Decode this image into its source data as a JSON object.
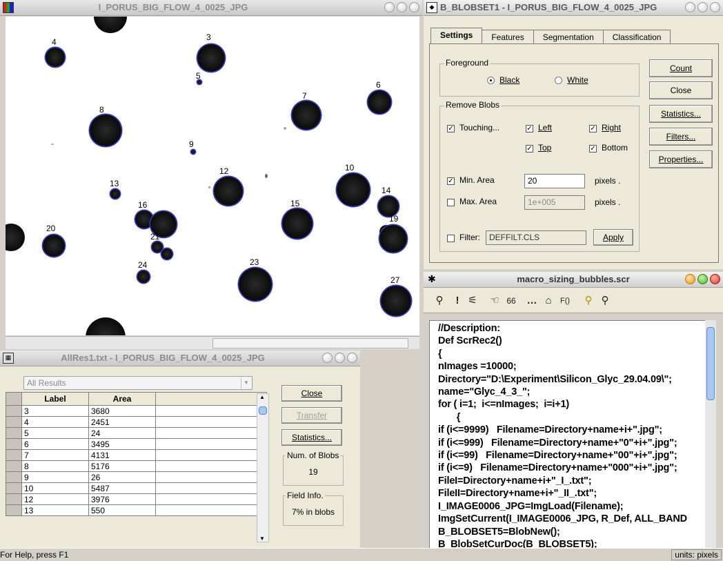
{
  "image_window": {
    "title": "I_PORUS_BIG_FLOW_4_0025_JPG",
    "blobs": [
      {
        "label": "3"
      },
      {
        "label": "4"
      },
      {
        "label": "5"
      },
      {
        "label": "6"
      },
      {
        "label": "7"
      },
      {
        "label": "8"
      },
      {
        "label": "9"
      },
      {
        "label": "10"
      },
      {
        "label": "12"
      },
      {
        "label": "13"
      },
      {
        "label": "14"
      },
      {
        "label": "15"
      },
      {
        "label": "16"
      },
      {
        "label": "19"
      },
      {
        "label": "20"
      },
      {
        "label": "21"
      },
      {
        "label": "23"
      },
      {
        "label": "24"
      },
      {
        "label": "27"
      }
    ]
  },
  "blobset_window": {
    "title": "B_BLOBSET1 - I_PORUS_BIG_FLOW_4_0025_JPG",
    "tabs": [
      "Settings",
      "Features",
      "Segmentation",
      "Classification"
    ],
    "foreground_label": "Foreground",
    "black_label": "Black",
    "white_label": "White",
    "foreground_value": "Black",
    "remove_blobs_label": "Remove Blobs",
    "touching_label": "Touching...",
    "left_label": "Left",
    "right_label": "Right",
    "top_label": "Top",
    "bottom_label": "Bottom",
    "min_area_label": "Min. Area",
    "min_area_value": "20",
    "max_area_label": "Max. Area",
    "max_area_value": "1e+005",
    "pixels_label": "pixels .",
    "filter_label": "Filter:",
    "filter_value": "DEFFILT.CLS",
    "apply_label": "Apply",
    "buttons": {
      "count": "Count",
      "close": "Close",
      "statistics": "Statistics...",
      "filters": "Filters...",
      "properties": "Properties..."
    }
  },
  "macro_window": {
    "title": "macro_sizing_bubbles.scr",
    "code": [
      "//Description:",
      "Def ScrRec2()",
      "{",
      "nImages =10000;",
      "Directory=\"D:\\Experiment\\Silicon_Glyc_29.04.09\\\";",
      "name=\"Glyc_4_3_\";",
      "for ( i=1;  i<=nImages;  i=i+1)",
      "       {",
      "if (i<=9999)   Filename=Directory+name+i+\".jpg\";",
      "if (i<=999)   Filename=Directory+name+\"0\"+i+\".jpg\";",
      "if (i<=99)   Filename=Directory+name+\"00\"+i+\".jpg\";",
      "if (i<=9)   Filename=Directory+name+\"000\"+i+\".jpg\";",
      "FileI=Directory+name+i+\"_I_.txt\";",
      "FileII=Directory+name+i+\"_II_.txt\";",
      "I_IMAGE0006_JPG=ImgLoad(Filename);",
      "ImgSetCurrent(I_IMAGE0006_JPG, R_Def, ALL_BAND",
      "B_BLOBSET5=BlobNew();",
      "B_BlobSetCurDoc(B_BLOBSET5);"
    ]
  },
  "results_window": {
    "title": "AllRes1.txt - I_PORUS_BIG_FLOW_4_0025_JPG",
    "combo_value": "All Results",
    "columns": [
      "Label",
      "Area"
    ],
    "rows": [
      {
        "label": "3",
        "area": "3680"
      },
      {
        "label": "4",
        "area": "2451"
      },
      {
        "label": "5",
        "area": "24"
      },
      {
        "label": "6",
        "area": "3495"
      },
      {
        "label": "7",
        "area": "4131"
      },
      {
        "label": "8",
        "area": "5176"
      },
      {
        "label": "9",
        "area": "26"
      },
      {
        "label": "10",
        "area": "5487"
      },
      {
        "label": "12",
        "area": "3976"
      },
      {
        "label": "13",
        "area": "550"
      }
    ],
    "close_label": "Close",
    "transfer_label": "Transfer",
    "statistics_label": "Statistics...",
    "num_blobs_label": "Num. of Blobs",
    "num_blobs_value": "19",
    "field_info_label": "Field Info.",
    "field_info_value": "7% in blobs"
  },
  "status_bar": {
    "help_text": "For Help, press F1",
    "units_text": "units: pixels"
  }
}
